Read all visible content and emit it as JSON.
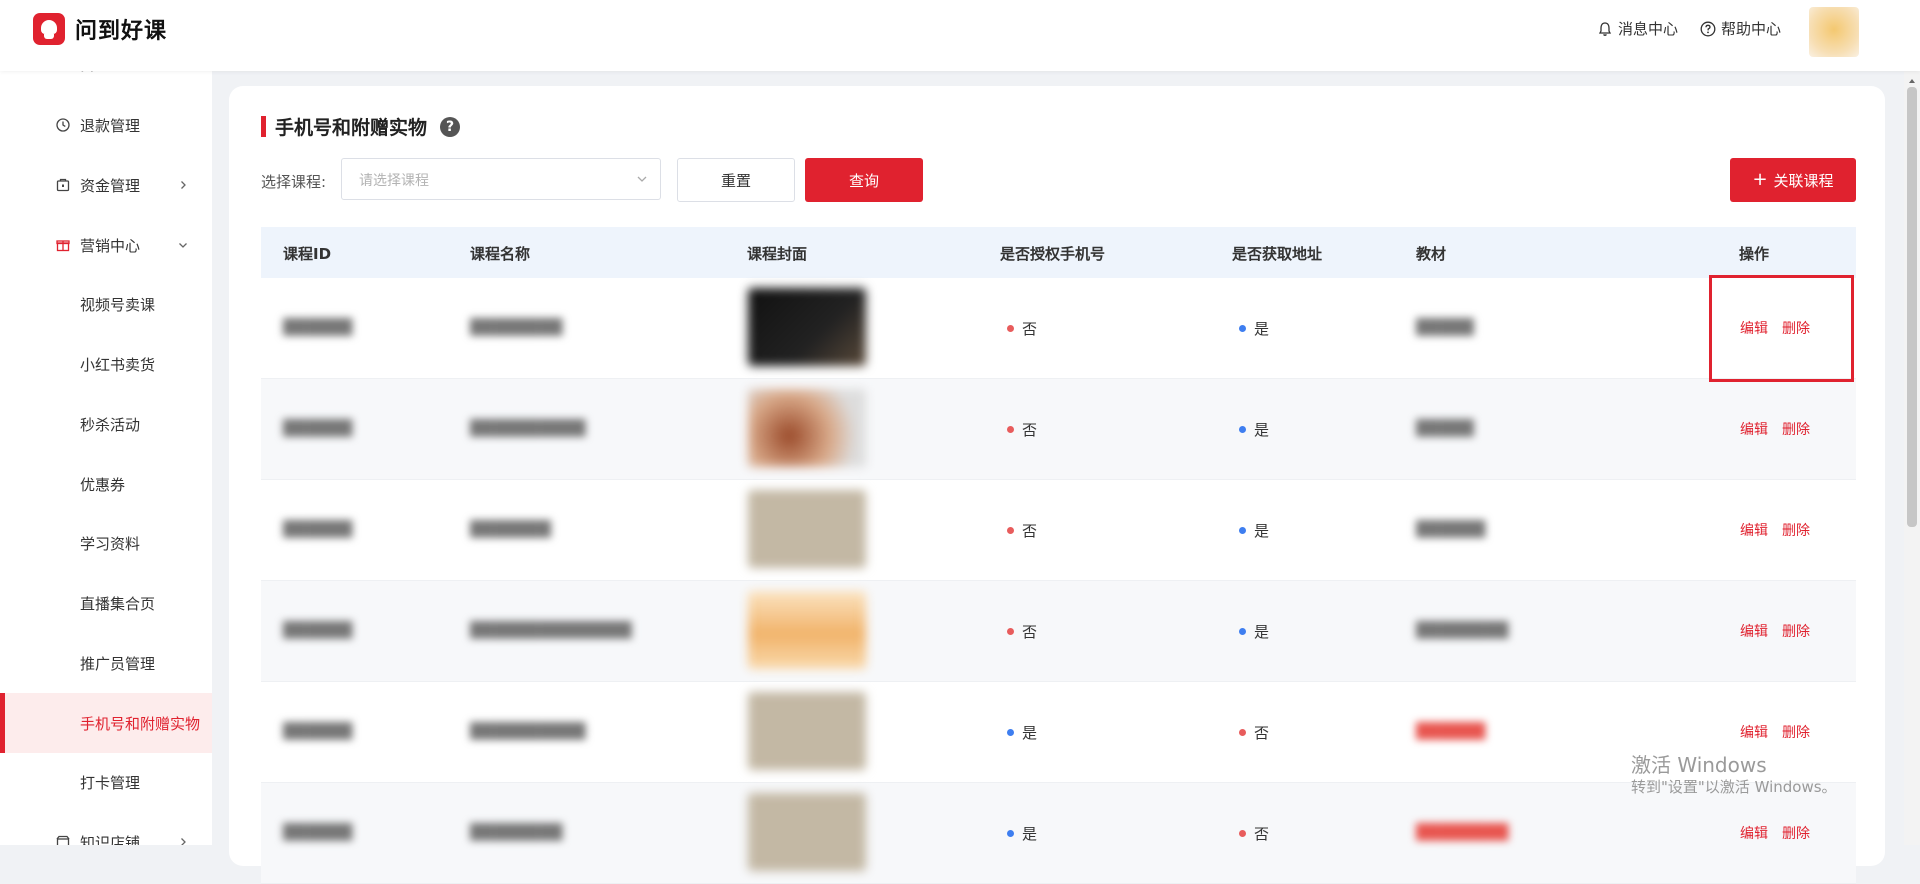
{
  "header": {
    "brand": "问到好课",
    "messages": "消息中心",
    "help": "帮助中心"
  },
  "sidebar": {
    "items": [
      {
        "label": "退款管理",
        "icon": "refund-icon"
      },
      {
        "label": "资金管理",
        "icon": "wallet-icon",
        "has_children": true
      },
      {
        "label": "营销中心",
        "icon": "gift-icon",
        "expanded": true
      },
      {
        "label": "视频号卖课"
      },
      {
        "label": "小红书卖货"
      },
      {
        "label": "秒杀活动"
      },
      {
        "label": "优惠券"
      },
      {
        "label": "学习资料"
      },
      {
        "label": "直播集合页"
      },
      {
        "label": "推广员管理"
      },
      {
        "label": "手机号和附赠实物",
        "active": true
      },
      {
        "label": "打卡管理"
      },
      {
        "label": "知识店铺",
        "icon": "store-icon",
        "has_children": true
      }
    ]
  },
  "page": {
    "title": "手机号和附赠实物",
    "help_icon": "?",
    "filter_label": "选择课程:",
    "select_placeholder": "请选择课程",
    "reset_button": "重置",
    "query_button": "查询",
    "add_button": "关联课程"
  },
  "table": {
    "columns": [
      "课程ID",
      "课程名称",
      "课程封面",
      "是否授权手机号",
      "是否获取地址",
      "教材",
      "操作"
    ],
    "rows": [
      {
        "id": "██████",
        "name": "████████",
        "auth_phone": "否",
        "get_address": "是",
        "material": "█████",
        "edit": "编辑",
        "delete": "删除"
      },
      {
        "id": "██████",
        "name": "██████████",
        "auth_phone": "否",
        "get_address": "是",
        "material": "█████",
        "edit": "编辑",
        "delete": "删除"
      },
      {
        "id": "██████",
        "name": "███████",
        "auth_phone": "否",
        "get_address": "是",
        "material": "██████",
        "edit": "编辑",
        "delete": "删除"
      },
      {
        "id": "██████",
        "name": "██████████████",
        "auth_phone": "否",
        "get_address": "是",
        "material": "████████",
        "edit": "编辑",
        "delete": "删除"
      },
      {
        "id": "██████",
        "name": "██████████",
        "auth_phone": "是",
        "get_address": "否",
        "material": "██████",
        "edit": "编辑",
        "delete": "删除"
      },
      {
        "id": "██████",
        "name": "████████",
        "auth_phone": "是",
        "get_address": "否",
        "material": "████████",
        "edit": "编辑",
        "delete": "删除"
      }
    ]
  },
  "watermark": {
    "line1": "激活 Windows",
    "line2": "转到\"设置\"以激活 Windows。"
  },
  "colors": {
    "brand": "#e0222f",
    "no_dot": "#e85c5c",
    "yes_dot": "#3e7ef0"
  }
}
